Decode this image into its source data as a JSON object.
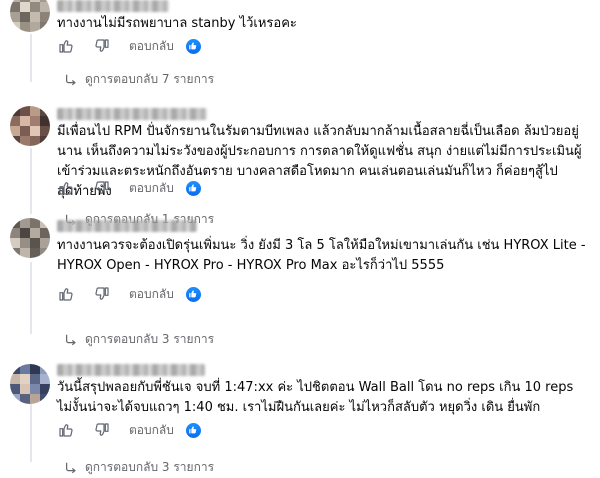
{
  "comments": [
    {
      "text": "ทางงานไม่มีรถพยาบาล stanby ไว้เหรอคะ",
      "reply_label": "ตอบกลับ",
      "view_replies": "ดูการตอบกลับ 7 รายการ"
    },
    {
      "text": "มีเพื่อนไป RPM ปั่นจักรยานในรัมตามบีทเพลง แล้วกลับมากล้ามเนื้อสลายฉี่เป็นเลือด ล้มป่วยอยู่นาน เห็นถึงความไม่ระวังของผู้ประกอบการ การตลาดให้ดูแฟชั่น สนุก ง่ายแต่ไม่มีการประเมินผู้เข้าร่วมและตระหนักถึงอันตราย บางคลาสดือโหดมาก คนเล่นตอนเล่นมันก็ไหว ก็ค่อยๆสู้ไป สุดท้ายพัง",
      "reply_label": "ตอบกลับ",
      "view_replies": "ดูการตอบกลับ 1 รายการ"
    },
    {
      "text": "ทางงานควรจะต้องเปิดรุ่นเพิ่มนะ วิ่ง ยังมี 3 โล 5 โลให้มือใหม่เขามาเล่นกัน เช่น HYROX Lite - HYROX Open - HYROX Pro - HYROX Pro Max อะไรก็ว่าไป 5555",
      "reply_label": "ตอบกลับ",
      "view_replies": "ดูการตอบกลับ 3 รายการ"
    },
    {
      "text": "วันนี้สรุปพลอยกับพี่ชันเจ จบที่ 1:47:xx ค่ะ ไปชิตตอน Wall Ball โดน no reps เกิน 10 reps ไม่งั้นน่าจะได้จบแถวๆ 1:40 ชม. เราไม่ฝืนกันเลยค่ะ ไม่ไหวก็สลับตัว หยุดวิ่ง เดิน ยื่นพัก",
      "reply_label": "ตอบกลับ",
      "view_replies": "ดูการตอบกลับ 3 รายการ"
    }
  ],
  "colors": {
    "secondary_text": "#65676b",
    "like_blue": "#0a6cf0",
    "icon_gray": "#606770"
  },
  "icons": {
    "like": "thumb-up-outline-icon",
    "dislike": "thumb-down-outline-icon",
    "reaction": "like-reaction-icon",
    "expand": "reply-arrow-icon"
  }
}
